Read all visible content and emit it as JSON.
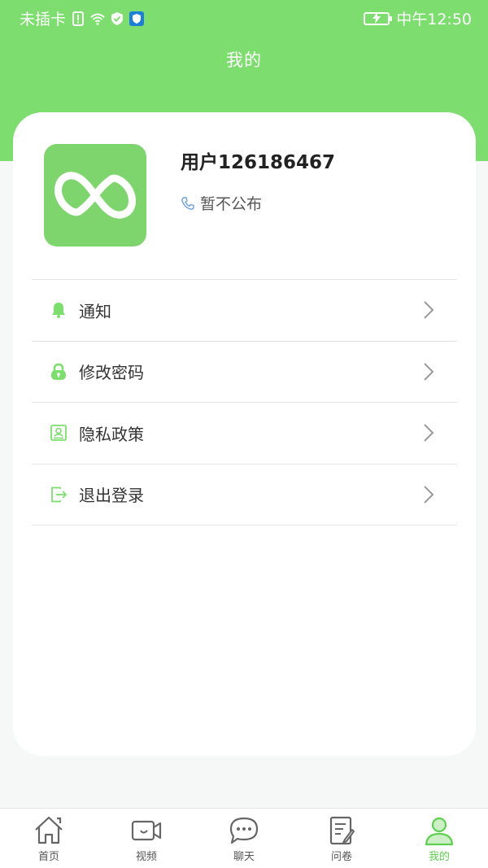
{
  "status_bar": {
    "carrier": "未插卡",
    "time": "中午12:50"
  },
  "header": {
    "title": "我的"
  },
  "profile": {
    "username": "用户126186467",
    "phone": "暂不公布"
  },
  "menu": [
    {
      "label": "通知",
      "icon": "bell-icon"
    },
    {
      "label": "修改密码",
      "icon": "lock-icon"
    },
    {
      "label": "隐私政策",
      "icon": "id-card-icon"
    },
    {
      "label": "退出登录",
      "icon": "logout-icon"
    }
  ],
  "tabs": [
    {
      "label": "首页",
      "icon": "home-icon"
    },
    {
      "label": "视频",
      "icon": "video-icon"
    },
    {
      "label": "聊天",
      "icon": "chat-icon"
    },
    {
      "label": "问卷",
      "icon": "survey-icon"
    },
    {
      "label": "我的",
      "icon": "profile-icon",
      "active": true
    }
  ],
  "colors": {
    "accent": "#7ddd6f",
    "active_tab": "#5fcf52",
    "background": "#f6f8f7"
  }
}
